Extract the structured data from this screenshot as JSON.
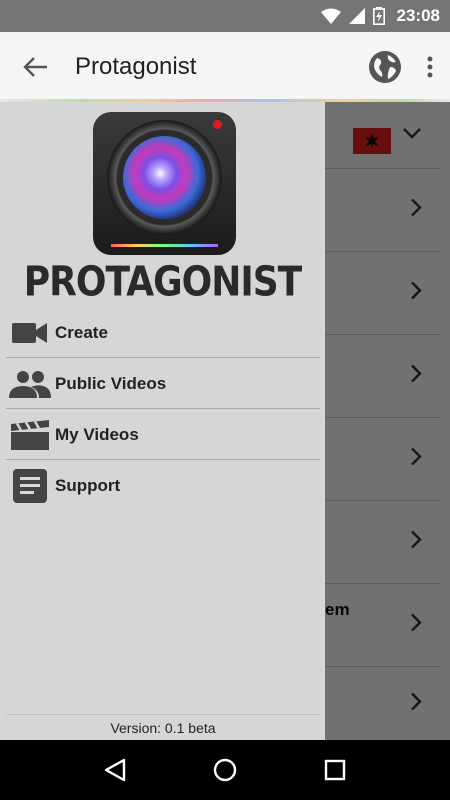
{
  "status_bar": {
    "time": "23:08"
  },
  "app_bar": {
    "title": "Protagonist",
    "back_icon": "arrow-back-icon",
    "globe_icon": "globe-icon",
    "more_icon": "more-vert-icon"
  },
  "drawer": {
    "logo_text": "PROTAGONIST",
    "items": [
      {
        "label": "Create",
        "icon": "videocam-icon"
      },
      {
        "label": "Public Videos",
        "icon": "people-icon"
      },
      {
        "label": "My Videos",
        "icon": "clapperboard-icon"
      },
      {
        "label": "Support",
        "icon": "document-icon"
      }
    ],
    "version": "Version: 0.1 beta"
  },
  "background": {
    "partial_text": "em"
  },
  "colors": {
    "drawer_bg": "#d6d6d6",
    "appbar_bg": "#f5f5f5",
    "status_bg": "#757575",
    "flag_red": "#e41e20"
  }
}
